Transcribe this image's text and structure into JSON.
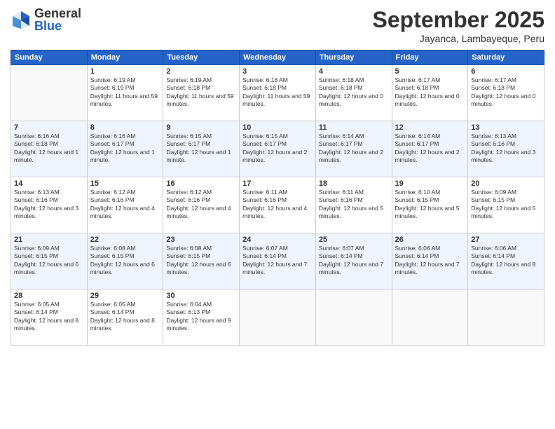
{
  "logo": {
    "general": "General",
    "blue": "Blue"
  },
  "title": {
    "month": "September 2025",
    "location": "Jayanca, Lambayeque, Peru"
  },
  "headers": [
    "Sunday",
    "Monday",
    "Tuesday",
    "Wednesday",
    "Thursday",
    "Friday",
    "Saturday"
  ],
  "weeks": [
    [
      {
        "num": "",
        "sunrise": "",
        "sunset": "",
        "daylight": "",
        "empty": true
      },
      {
        "num": "1",
        "sunrise": "Sunrise: 6:19 AM",
        "sunset": "Sunset: 6:19 PM",
        "daylight": "Daylight: 11 hours and 59 minutes."
      },
      {
        "num": "2",
        "sunrise": "Sunrise: 6:19 AM",
        "sunset": "Sunset: 6:18 PM",
        "daylight": "Daylight: 11 hours and 59 minutes."
      },
      {
        "num": "3",
        "sunrise": "Sunrise: 6:18 AM",
        "sunset": "Sunset: 6:18 PM",
        "daylight": "Daylight: 11 hours and 59 minutes."
      },
      {
        "num": "4",
        "sunrise": "Sunrise: 6:18 AM",
        "sunset": "Sunset: 6:18 PM",
        "daylight": "Daylight: 12 hours and 0 minutes."
      },
      {
        "num": "5",
        "sunrise": "Sunrise: 6:17 AM",
        "sunset": "Sunset: 6:18 PM",
        "daylight": "Daylight: 12 hours and 0 minutes."
      },
      {
        "num": "6",
        "sunrise": "Sunrise: 6:17 AM",
        "sunset": "Sunset: 6:18 PM",
        "daylight": "Daylight: 12 hours and 0 minutes."
      }
    ],
    [
      {
        "num": "7",
        "sunrise": "Sunrise: 6:16 AM",
        "sunset": "Sunset: 6:18 PM",
        "daylight": "Daylight: 12 hours and 1 minute."
      },
      {
        "num": "8",
        "sunrise": "Sunrise: 6:16 AM",
        "sunset": "Sunset: 6:17 PM",
        "daylight": "Daylight: 12 hours and 1 minute."
      },
      {
        "num": "9",
        "sunrise": "Sunrise: 6:15 AM",
        "sunset": "Sunset: 6:17 PM",
        "daylight": "Daylight: 12 hours and 1 minute."
      },
      {
        "num": "10",
        "sunrise": "Sunrise: 6:15 AM",
        "sunset": "Sunset: 6:17 PM",
        "daylight": "Daylight: 12 hours and 2 minutes."
      },
      {
        "num": "11",
        "sunrise": "Sunrise: 6:14 AM",
        "sunset": "Sunset: 6:17 PM",
        "daylight": "Daylight: 12 hours and 2 minutes."
      },
      {
        "num": "12",
        "sunrise": "Sunrise: 6:14 AM",
        "sunset": "Sunset: 6:17 PM",
        "daylight": "Daylight: 12 hours and 2 minutes."
      },
      {
        "num": "13",
        "sunrise": "Sunrise: 6:13 AM",
        "sunset": "Sunset: 6:16 PM",
        "daylight": "Daylight: 12 hours and 3 minutes."
      }
    ],
    [
      {
        "num": "14",
        "sunrise": "Sunrise: 6:13 AM",
        "sunset": "Sunset: 6:16 PM",
        "daylight": "Daylight: 12 hours and 3 minutes."
      },
      {
        "num": "15",
        "sunrise": "Sunrise: 6:12 AM",
        "sunset": "Sunset: 6:16 PM",
        "daylight": "Daylight: 12 hours and 4 minutes."
      },
      {
        "num": "16",
        "sunrise": "Sunrise: 6:12 AM",
        "sunset": "Sunset: 6:16 PM",
        "daylight": "Daylight: 12 hours and 4 minutes."
      },
      {
        "num": "17",
        "sunrise": "Sunrise: 6:11 AM",
        "sunset": "Sunset: 6:16 PM",
        "daylight": "Daylight: 12 hours and 4 minutes."
      },
      {
        "num": "18",
        "sunrise": "Sunrise: 6:11 AM",
        "sunset": "Sunset: 6:16 PM",
        "daylight": "Daylight: 12 hours and 5 minutes."
      },
      {
        "num": "19",
        "sunrise": "Sunrise: 6:10 AM",
        "sunset": "Sunset: 6:15 PM",
        "daylight": "Daylight: 12 hours and 5 minutes."
      },
      {
        "num": "20",
        "sunrise": "Sunrise: 6:09 AM",
        "sunset": "Sunset: 6:15 PM",
        "daylight": "Daylight: 12 hours and 5 minutes."
      }
    ],
    [
      {
        "num": "21",
        "sunrise": "Sunrise: 6:09 AM",
        "sunset": "Sunset: 6:15 PM",
        "daylight": "Daylight: 12 hours and 6 minutes."
      },
      {
        "num": "22",
        "sunrise": "Sunrise: 6:08 AM",
        "sunset": "Sunset: 6:15 PM",
        "daylight": "Daylight: 12 hours and 6 minutes."
      },
      {
        "num": "23",
        "sunrise": "Sunrise: 6:08 AM",
        "sunset": "Sunset: 6:15 PM",
        "daylight": "Daylight: 12 hours and 6 minutes."
      },
      {
        "num": "24",
        "sunrise": "Sunrise: 6:07 AM",
        "sunset": "Sunset: 6:14 PM",
        "daylight": "Daylight: 12 hours and 7 minutes."
      },
      {
        "num": "25",
        "sunrise": "Sunrise: 6:07 AM",
        "sunset": "Sunset: 6:14 PM",
        "daylight": "Daylight: 12 hours and 7 minutes."
      },
      {
        "num": "26",
        "sunrise": "Sunrise: 6:06 AM",
        "sunset": "Sunset: 6:14 PM",
        "daylight": "Daylight: 12 hours and 7 minutes."
      },
      {
        "num": "27",
        "sunrise": "Sunrise: 6:06 AM",
        "sunset": "Sunset: 6:14 PM",
        "daylight": "Daylight: 12 hours and 8 minutes."
      }
    ],
    [
      {
        "num": "28",
        "sunrise": "Sunrise: 6:05 AM",
        "sunset": "Sunset: 6:14 PM",
        "daylight": "Daylight: 12 hours and 8 minutes."
      },
      {
        "num": "29",
        "sunrise": "Sunrise: 6:05 AM",
        "sunset": "Sunset: 6:14 PM",
        "daylight": "Daylight: 12 hours and 8 minutes."
      },
      {
        "num": "30",
        "sunrise": "Sunrise: 6:04 AM",
        "sunset": "Sunset: 6:13 PM",
        "daylight": "Daylight: 12 hours and 9 minutes."
      },
      {
        "num": "",
        "sunrise": "",
        "sunset": "",
        "daylight": "",
        "empty": true
      },
      {
        "num": "",
        "sunrise": "",
        "sunset": "",
        "daylight": "",
        "empty": true
      },
      {
        "num": "",
        "sunrise": "",
        "sunset": "",
        "daylight": "",
        "empty": true
      },
      {
        "num": "",
        "sunrise": "",
        "sunset": "",
        "daylight": "",
        "empty": true
      }
    ]
  ]
}
